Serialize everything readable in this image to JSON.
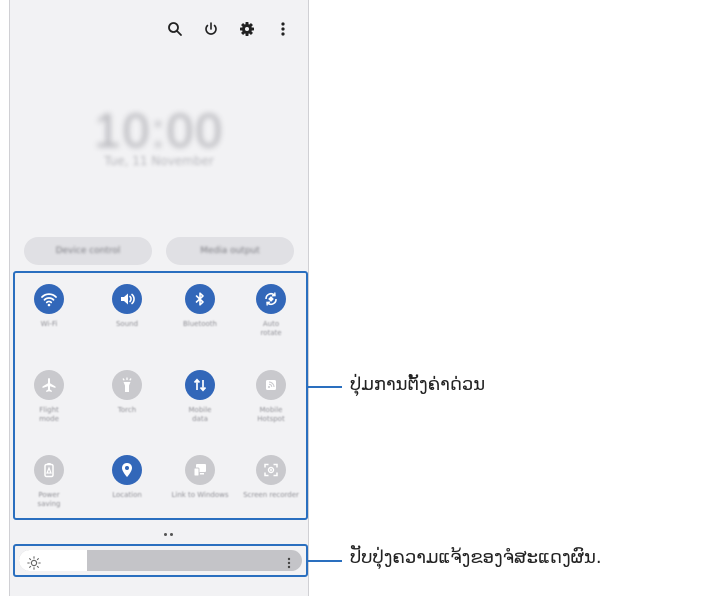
{
  "accent_color": "#3267b9",
  "callout_color": "#2a6fbf",
  "top_icons": [
    "search-icon",
    "power-icon",
    "settings-icon",
    "more-options-icon"
  ],
  "lock": {
    "time": "10:00",
    "date": "Tue, 11 November"
  },
  "media": {
    "device_control": "Device control",
    "media_output": "Media output"
  },
  "tiles": [
    {
      "label": "Wi-Fi",
      "icon": "wifi-icon",
      "active": true
    },
    {
      "label": "Sound",
      "icon": "sound-icon",
      "active": true
    },
    {
      "label": "Bluetooth",
      "icon": "bluetooth-icon",
      "active": true
    },
    {
      "label": "Auto\nrotate",
      "icon": "auto-rotate-icon",
      "active": true
    },
    {
      "label": "Flight\nmode",
      "icon": "flight-mode-icon",
      "active": false
    },
    {
      "label": "Torch",
      "icon": "torch-icon",
      "active": false
    },
    {
      "label": "Mobile\ndata",
      "icon": "mobile-data-icon",
      "active": true
    },
    {
      "label": "Mobile\nHotspot",
      "icon": "hotspot-icon",
      "active": false
    },
    {
      "label": "Power\nsaving",
      "icon": "power-saving-icon",
      "active": false
    },
    {
      "label": "Location",
      "icon": "location-icon",
      "active": true
    },
    {
      "label": "Link to Windows",
      "icon": "link-to-windows-icon",
      "active": false
    },
    {
      "label": "Screen recorder",
      "icon": "screen-recorder-icon",
      "active": false
    }
  ],
  "page_indicator": {
    "pages": 2,
    "current": 1
  },
  "brightness": {
    "level": 0.24,
    "icon": "brightness-icon"
  },
  "callouts": {
    "quick_settings": "ປຸ່ມການຕັ້ງຄ່າດ່ວນ",
    "brightness": "ປັບປຸ່ງຄວາມແຈ້ງຂອງຈໍສະແດງຜົນ."
  }
}
